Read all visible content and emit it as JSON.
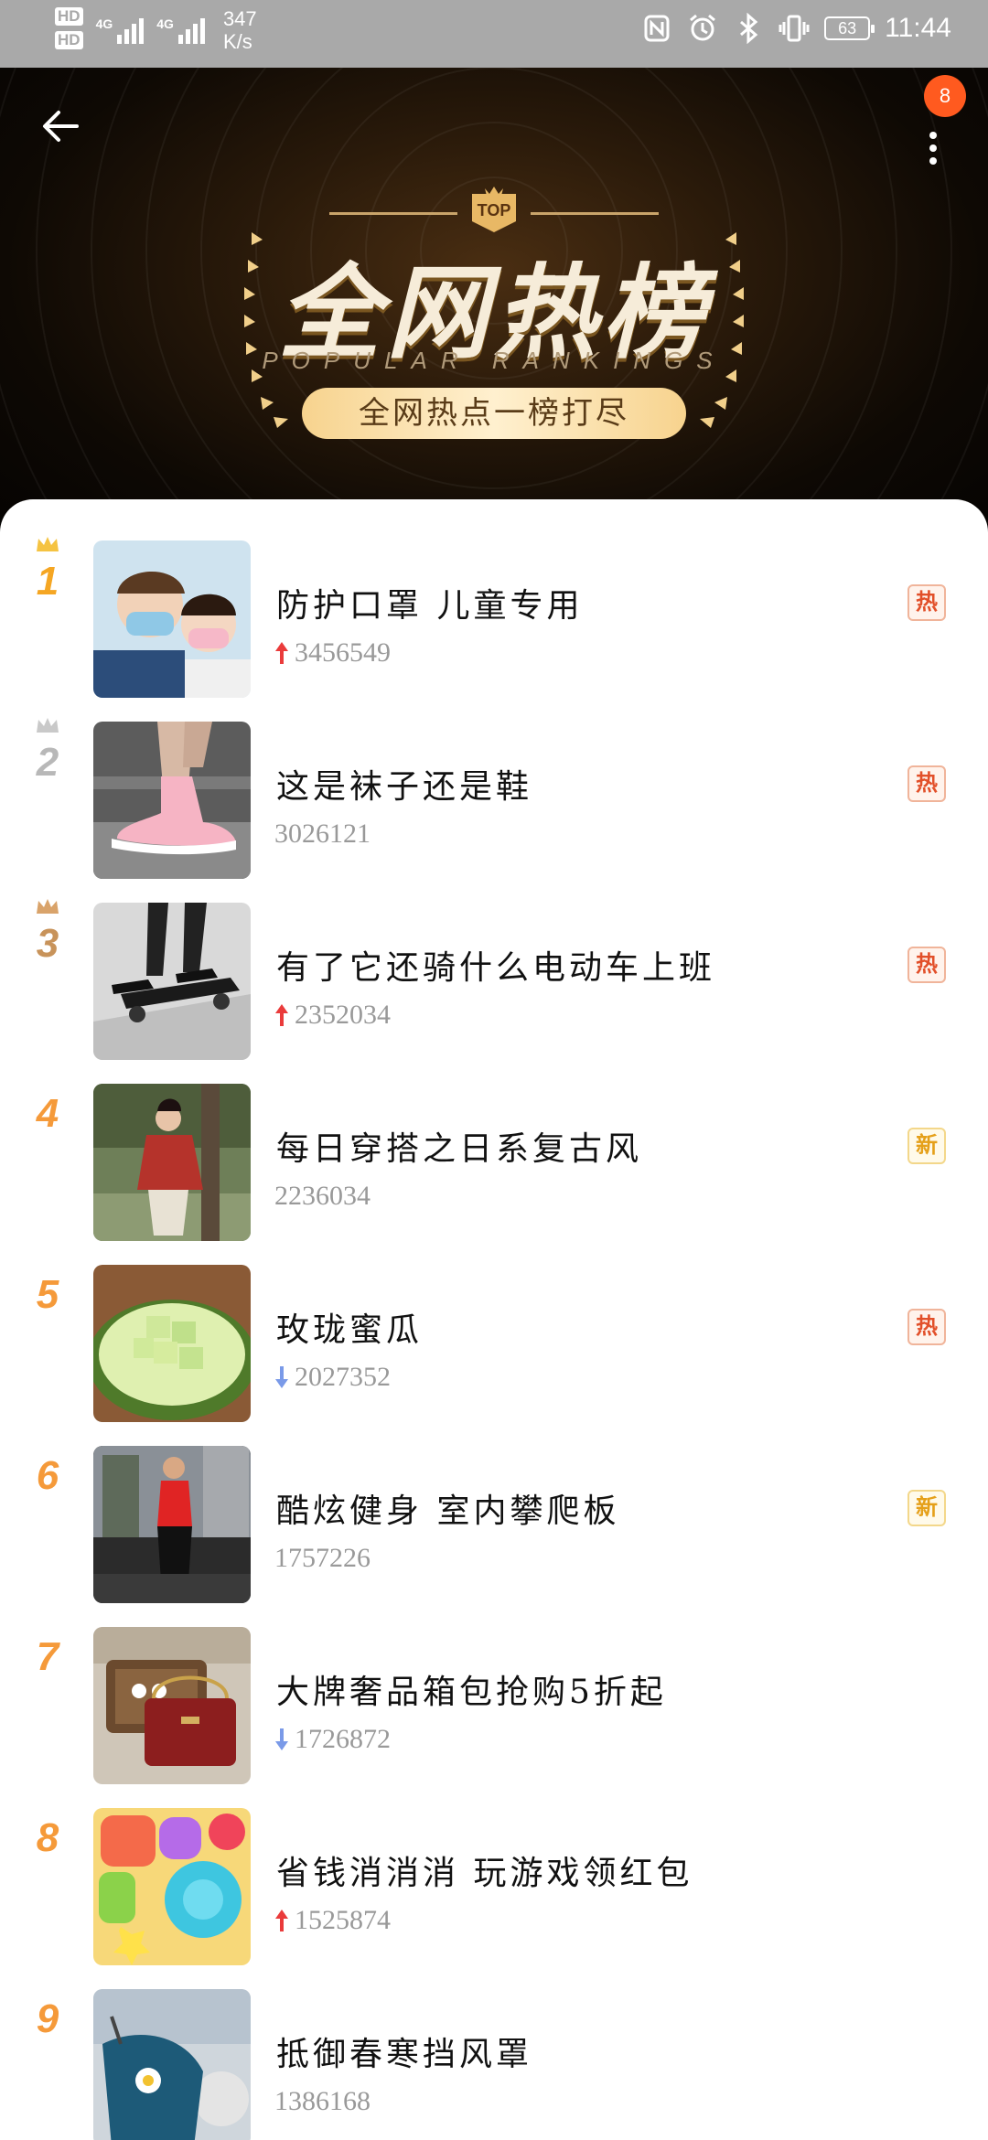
{
  "status_bar": {
    "hd1": "HD",
    "hd2": "HD",
    "net1": "4G",
    "net2": "4G",
    "speed_value": "347",
    "speed_unit": "K/s",
    "battery": "63",
    "time": "11:44"
  },
  "header": {
    "badge_count": "8",
    "top_label": "TOP",
    "title": "全网热榜",
    "subtitle_en": "POPULAR RANKINGS",
    "slogan": "全网热点一榜打尽",
    "colors": {
      "accent": "#f7d38e",
      "badge": "#ff5a1f"
    }
  },
  "list": [
    {
      "rank": "1",
      "title": "防护口罩 儿童专用",
      "value": "3456549",
      "trend": "up",
      "tag": "热",
      "tag_type": "hot",
      "crown": "gold",
      "rank_color": "#f5a623",
      "thumb": "kids-mask"
    },
    {
      "rank": "2",
      "title": "这是袜子还是鞋",
      "value": "3026121",
      "trend": "none",
      "tag": "热",
      "tag_type": "hot",
      "crown": "silver",
      "rank_color": "#b8b8b8",
      "thumb": "sock-shoe"
    },
    {
      "rank": "3",
      "title": "有了它还骑什么电动车上班",
      "value": "2352034",
      "trend": "up",
      "tag": "热",
      "tag_type": "hot",
      "crown": "bronze",
      "rank_color": "#c8935a",
      "thumb": "skateboard"
    },
    {
      "rank": "4",
      "title": "每日穿搭之日系复古风",
      "value": "2236034",
      "trend": "none",
      "tag": "新",
      "tag_type": "new",
      "crown": "",
      "rank_color": "#f59a3a",
      "thumb": "outfit"
    },
    {
      "rank": "5",
      "title": "玫珑蜜瓜",
      "value": "2027352",
      "trend": "down",
      "tag": "热",
      "tag_type": "hot",
      "crown": "",
      "rank_color": "#f59a3a",
      "thumb": "melon"
    },
    {
      "rank": "6",
      "title": "酷炫健身 室内攀爬板",
      "value": "1757226",
      "trend": "none",
      "tag": "新",
      "tag_type": "new",
      "crown": "",
      "rank_color": "#f59a3a",
      "thumb": "fitness"
    },
    {
      "rank": "7",
      "title": "大牌奢品箱包抢购5折起",
      "value": "1726872",
      "trend": "down",
      "tag": "",
      "tag_type": "",
      "crown": "",
      "rank_color": "#f59a3a",
      "thumb": "bags"
    },
    {
      "rank": "8",
      "title": "省钱消消消 玩游戏领红包",
      "value": "1525874",
      "trend": "up",
      "tag": "",
      "tag_type": "",
      "crown": "",
      "rank_color": "#f59a3a",
      "thumb": "game"
    },
    {
      "rank": "9",
      "title": "抵御春寒挡风罩",
      "value": "1386168",
      "trend": "none",
      "tag": "",
      "tag_type": "",
      "crown": "",
      "rank_color": "#f59a3a",
      "thumb": "windshield"
    }
  ]
}
